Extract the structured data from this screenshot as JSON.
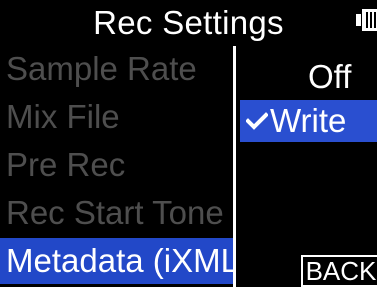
{
  "header": {
    "title": "Rec Settings",
    "battery_icon": "battery-icon"
  },
  "menu": {
    "items": [
      {
        "label": "Sample Rate",
        "selected": false
      },
      {
        "label": "Mix File",
        "selected": false
      },
      {
        "label": "Pre Rec",
        "selected": false
      },
      {
        "label": "Rec Start Tone",
        "selected": false
      },
      {
        "label": "Metadata (iXML)",
        "selected": true
      }
    ]
  },
  "options": {
    "off_label": "Off",
    "write_label": "Write",
    "write_checked": true,
    "check_icon": "check-icon"
  },
  "back_label": "BACK",
  "colors": {
    "background": "#000000",
    "selection": "#2248c8",
    "inactive_text": "#4e4e4e",
    "active_text": "#ffffff"
  }
}
